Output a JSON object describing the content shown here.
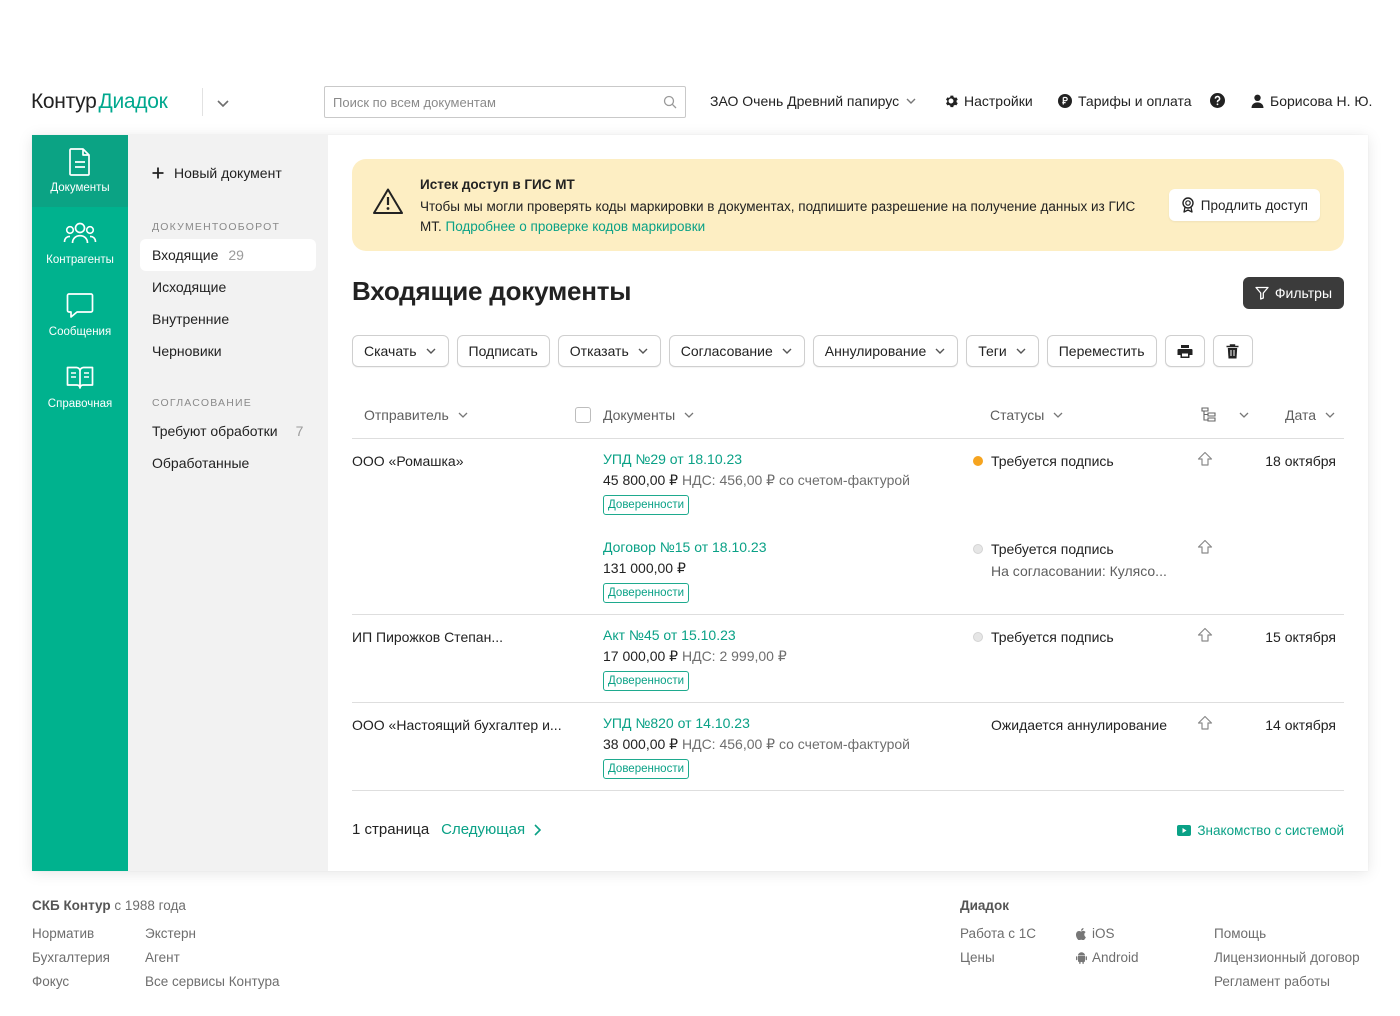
{
  "header": {
    "logo_part1": "Контур",
    "logo_part2": "Диадок",
    "search_placeholder": "Поиск по всем документам",
    "org": "ЗАО Очень Древний папирус",
    "settings": "Настройки",
    "tariffs": "Тарифы и оплата",
    "user": "Борисова Н. Ю."
  },
  "rail": [
    {
      "label": "Документы",
      "icon": "document-icon",
      "active": true
    },
    {
      "label": "Контрагенты",
      "icon": "contacts-icon"
    },
    {
      "label": "Сообщения",
      "icon": "chat-icon"
    },
    {
      "label": "Справочная",
      "icon": "book-icon"
    }
  ],
  "sidebar": {
    "new_doc": "Новый документ",
    "cap1": "Документооборот",
    "items1": [
      {
        "label": "Входящие",
        "count": "29"
      },
      {
        "label": "Исходящие"
      },
      {
        "label": "Внутренние"
      },
      {
        "label": "Черновики"
      }
    ],
    "cap2": "Согласование",
    "items2": [
      {
        "label": "Требуют обработки",
        "count": "7"
      },
      {
        "label": "Обработанные"
      }
    ]
  },
  "banner": {
    "title": "Истек доступ в ГИС МТ",
    "text": "Чтобы мы могли проверять коды маркировки в документах, подпишите разрешение на получение данных из ГИС МТ. ",
    "link": "Подробнее о проверке кодов маркировки",
    "button": "Продлить доступ",
    "bg": "#fdeec3"
  },
  "main": {
    "title": "Входящие документы",
    "filters": "Фильтры"
  },
  "toolbar": [
    "Скачать",
    "Подписать",
    "Отказать",
    "Согласование",
    "Аннулирование",
    "Теги",
    "Переместить"
  ],
  "table": {
    "columns": {
      "sender": "Отправитель",
      "docs": "Документы",
      "status": "Статусы",
      "date": "Дата"
    },
    "tag_label": "Доверенности",
    "rows": [
      {
        "sender": "ООО «Ромашка»",
        "date": "18 октября",
        "docs": [
          {
            "title": "УПД №29 от 18.10.23",
            "amount": "45 800,00 ₽",
            "vat": " НДС: 456,00 ₽ со счетом-фактурой",
            "status": "Требуется подпись",
            "dot": "orange"
          },
          {
            "title": "Договор №15 от 18.10.23",
            "amount": "131 000,00 ₽",
            "vat": "",
            "status": "Требуется подпись",
            "dot": "grey",
            "sub": "На согласовании: Кулясо..."
          }
        ]
      },
      {
        "sender": "ИП Пирожков Степан...",
        "date": "15 октября",
        "docs": [
          {
            "title": "Акт №45 от 15.10.23",
            "amount": "17 000,00 ₽",
            "vat": " НДС: 2 999,00 ₽",
            "status": "Требуется подпись",
            "dot": "grey"
          }
        ]
      },
      {
        "sender": "ООО «Настоящий бухгалтер и...",
        "date": "14 октября",
        "docs": [
          {
            "title": "УПД №820 от 14.10.23",
            "amount": "38 000,00 ₽",
            "vat": " НДС: 456,00 ₽ со счетом-фактурой",
            "status": "Ожидается аннулирование",
            "dot": "none"
          }
        ]
      }
    ]
  },
  "pager": {
    "page": "1 страница",
    "next": "Следующая",
    "intro": "Знакомство с системой"
  },
  "footer": {
    "company_bold": "СКБ Контур",
    "company_rest": " с 1988 года",
    "col1": [
      "Норматив",
      "Бухгалтерия",
      "Фокус"
    ],
    "col2": [
      "Экстерн",
      "Агент",
      "Все сервисы Контура"
    ],
    "diadoc_head": "Диадок",
    "col3": [
      "Работа с 1С",
      "Цены"
    ],
    "col4": [
      "iOS",
      "Android"
    ],
    "col5": [
      "Помощь",
      "Лицензионный договор",
      "Регламент работы"
    ]
  },
  "colors": {
    "accent": "#00b28e",
    "link": "#0aa186",
    "status_orange": "#f6a41f"
  }
}
